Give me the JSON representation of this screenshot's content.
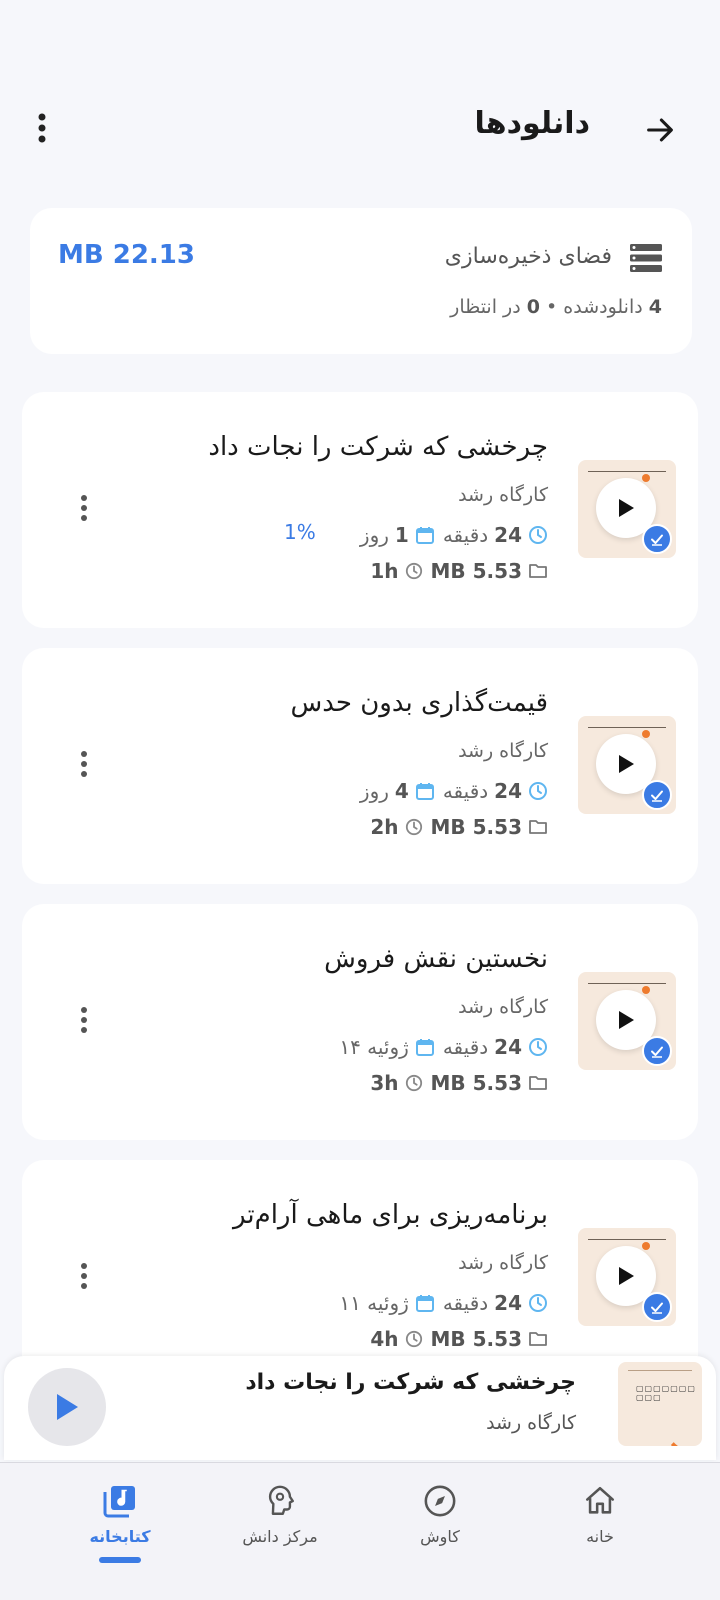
{
  "header": {
    "title": "دانلودها",
    "back_icon": "arrow-right-icon",
    "more_icon": "more-vert-icon"
  },
  "storage": {
    "label": "فضای ذخیره‌سازی",
    "size": "MB 22.13",
    "downloaded_count": "4",
    "downloaded_label": "دانلودشده",
    "separator": "•",
    "pending_count": "0",
    "pending_label": "در انتظار"
  },
  "episodes": [
    {
      "title": "چرخشی که شرکت را نجات داد",
      "author": "کارگاه رشد",
      "duration_value": "24",
      "duration_unit": "دقیقه",
      "date_value": "1",
      "date_unit": "روز",
      "progress": "1%",
      "size": "MB 5.53",
      "time": "1h"
    },
    {
      "title": "قیمت‌گذاری بدون حدس",
      "author": "کارگاه رشد",
      "duration_value": "24",
      "duration_unit": "دقیقه",
      "date_value": "4",
      "date_unit": "روز",
      "progress": "",
      "size": "MB 5.53",
      "time": "2h"
    },
    {
      "title": "نخستین نقش فروش",
      "author": "کارگاه رشد",
      "duration_value": "24",
      "duration_unit": "دقیقه",
      "date_value": "۱۴ ژوئیه",
      "date_unit": "",
      "progress": "",
      "size": "MB 5.53",
      "time": "3h"
    },
    {
      "title": "برنامه‌ریزی برای ماهی آرام‌تر",
      "author": "کارگاه رشد",
      "duration_value": "24",
      "duration_unit": "دقیقه",
      "date_value": "۱۱ ژوئیه",
      "date_unit": "",
      "progress": "",
      "size": "MB 5.53",
      "time": "4h"
    }
  ],
  "mini_player": {
    "title": "چرخشی که شرکت را نجات داد",
    "author": "کارگاه رشد",
    "thumb_text": "▢▢▢▢▢▢▢ ▢▢▢"
  },
  "nav": {
    "items": [
      {
        "label": "خانه",
        "icon": "home-icon"
      },
      {
        "label": "کاوش",
        "icon": "compass-icon"
      },
      {
        "label": "مرکز دانش",
        "icon": "brain-icon"
      },
      {
        "label": "کتابخانه",
        "icon": "library-icon",
        "active": true
      }
    ]
  },
  "colors": {
    "accent": "#3b7be4",
    "orange": "#ee7b2e",
    "calendar_icon": "#5fb6f0"
  }
}
